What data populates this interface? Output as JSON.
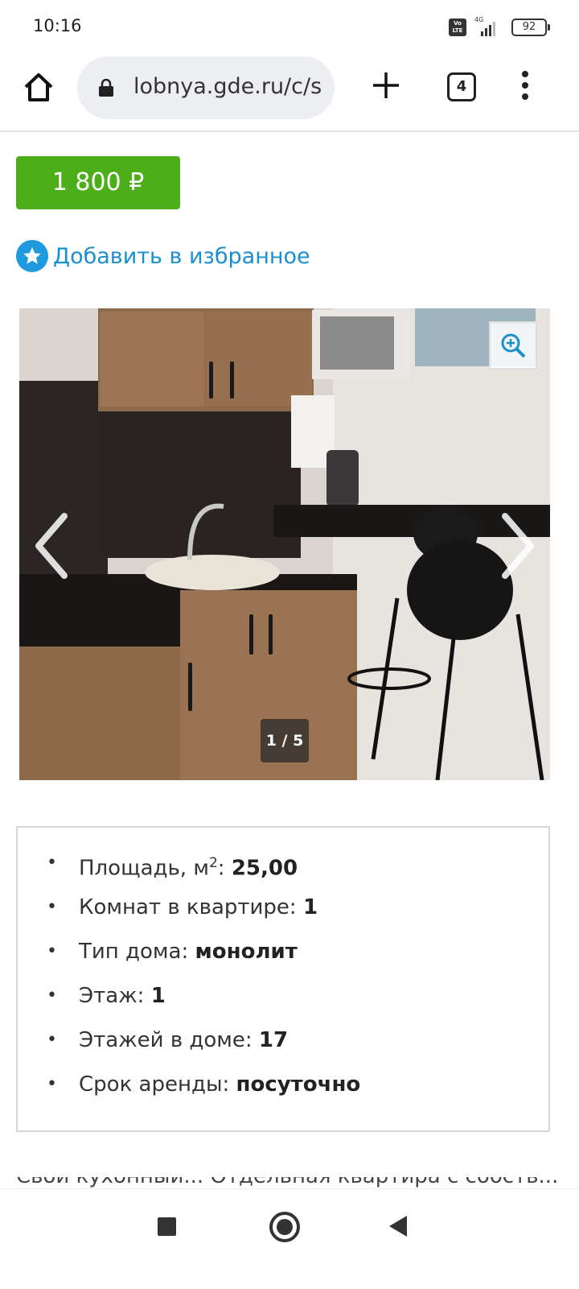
{
  "status_bar": {
    "time": "10:16",
    "volte_line1": "Vo",
    "volte_line2": "LTE",
    "network": "4G",
    "battery": "92"
  },
  "browser": {
    "url": "lobnya.gde.ru/c/s",
    "tab_count": "4",
    "icons": [
      "home-icon",
      "lock-icon",
      "plus-icon",
      "tabs-icon",
      "more-vert-icon"
    ]
  },
  "listing": {
    "price": "1 800 ₽",
    "favorite_label": "Добавить в избранное",
    "gallery": {
      "counter": "1 / 5",
      "current": 1,
      "total": 5
    },
    "properties": [
      {
        "label": "Площадь, м",
        "sup": "2",
        "sep": ": ",
        "value": "25,00"
      },
      {
        "label": "Комнат в квартире: ",
        "value": "1"
      },
      {
        "label": "Тип дома: ",
        "value": "монолит"
      },
      {
        "label": "Этаж: ",
        "value": "1"
      },
      {
        "label": "Этажей в доме: ",
        "value": "17"
      },
      {
        "label": "Срок аренды: ",
        "value": "посуточно"
      }
    ],
    "description_cut": "Свой кухонный... Отдельная квартира с собств..."
  },
  "colors": {
    "price_bg": "#4caf1a",
    "link": "#1a8fcf",
    "fav_icon": "#1e9be0"
  }
}
